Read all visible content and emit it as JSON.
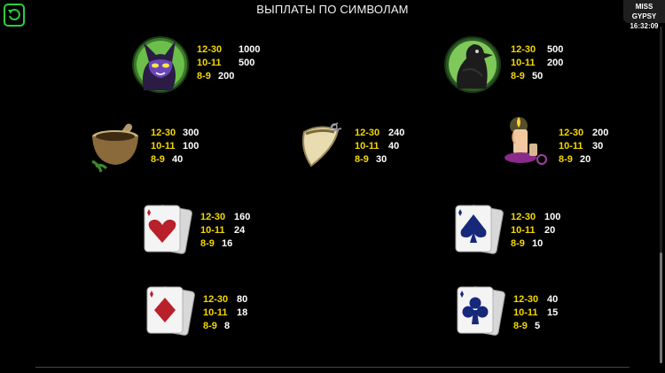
{
  "header": {
    "title": "ВЫПЛАТЫ ПО СИМВОЛАМ",
    "game_name": "MISS GYPSY",
    "clock": "16:32:09"
  },
  "colors": {
    "accent": "#2ecc40",
    "range": "#f5d800",
    "value": "#ffffff"
  },
  "symbols": [
    {
      "name": "black-cat",
      "icon": "cat-icon",
      "rows": [
        {
          "range": "12-30",
          "value": "1000"
        },
        {
          "range": "10-11",
          "value": "500"
        },
        {
          "range": "8-9",
          "value": "200"
        }
      ]
    },
    {
      "name": "raven",
      "icon": "raven-icon",
      "rows": [
        {
          "range": "12-30",
          "value": "500"
        },
        {
          "range": "10-11",
          "value": "200"
        },
        {
          "range": "8-9",
          "value": "50"
        }
      ]
    },
    {
      "name": "mortar",
      "icon": "mortar-icon",
      "rows": [
        {
          "range": "12-30",
          "value": "300"
        },
        {
          "range": "10-11",
          "value": "100"
        },
        {
          "range": "8-9",
          "value": "40"
        }
      ]
    },
    {
      "name": "fang",
      "icon": "fang-icon",
      "rows": [
        {
          "range": "12-30",
          "value": "240"
        },
        {
          "range": "10-11",
          "value": "40"
        },
        {
          "range": "8-9",
          "value": "30"
        }
      ]
    },
    {
      "name": "candle",
      "icon": "candle-icon",
      "rows": [
        {
          "range": "12-30",
          "value": "200"
        },
        {
          "range": "10-11",
          "value": "30"
        },
        {
          "range": "8-9",
          "value": "20"
        }
      ]
    },
    {
      "name": "hearts-card",
      "icon": "hearts-card-icon",
      "rows": [
        {
          "range": "12-30",
          "value": "160"
        },
        {
          "range": "10-11",
          "value": "24"
        },
        {
          "range": "8-9",
          "value": "16"
        }
      ]
    },
    {
      "name": "spades-card",
      "icon": "spades-card-icon",
      "rows": [
        {
          "range": "12-30",
          "value": "100"
        },
        {
          "range": "10-11",
          "value": "20"
        },
        {
          "range": "8-9",
          "value": "10"
        }
      ]
    },
    {
      "name": "diamonds-card",
      "icon": "diamonds-card-icon",
      "rows": [
        {
          "range": "12-30",
          "value": "80"
        },
        {
          "range": "10-11",
          "value": "18"
        },
        {
          "range": "8-9",
          "value": "8"
        }
      ]
    },
    {
      "name": "clubs-card",
      "icon": "clubs-card-icon",
      "rows": [
        {
          "range": "12-30",
          "value": "40"
        },
        {
          "range": "10-11",
          "value": "15"
        },
        {
          "range": "8-9",
          "value": "5"
        }
      ]
    }
  ]
}
